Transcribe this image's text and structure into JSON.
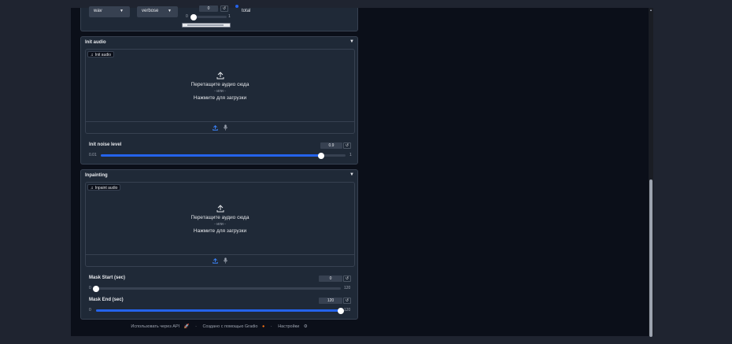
{
  "top": {
    "format_select": "wav",
    "log_select": "verbose",
    "small_num": "0",
    "small_min": "0",
    "small_max": "1",
    "total_label": "total"
  },
  "init_audio": {
    "title": "Init audio",
    "upload_label": "Init audio",
    "drop_text": "Перетащите аудио сюда",
    "or_text": "- или -",
    "click_text": "Нажмите для загрузки",
    "noise_label": "Init noise level",
    "noise_value": "0.9",
    "noise_min": "0.01",
    "noise_max": "1",
    "noise_fraction": 0.9
  },
  "inpainting": {
    "title": "Inpainting",
    "upload_label": "Inpaint audio",
    "drop_text": "Перетащите аудио сюда",
    "or_text": "- или -",
    "click_text": "Нажмите для загрузки",
    "mask_start_label": "Mask Start (sec)",
    "mask_start_value": "0",
    "mask_start_min": "0",
    "mask_start_max": "120",
    "mask_start_fraction": 0,
    "mask_end_label": "Mask End (sec)",
    "mask_end_value": "120",
    "mask_end_min": "0",
    "mask_end_max": "120",
    "mask_end_fraction": 1
  },
  "footer": {
    "api": "Использовать через API",
    "sep1": "·",
    "gradio": "Создано с помощью Gradio",
    "sep2": "·",
    "settings": "Настройки"
  },
  "colors": {
    "accent": "#2563eb",
    "panel": "#1f2937",
    "background": "#0b0f19"
  },
  "icons": [
    "upload-icon",
    "microphone-icon",
    "music-note-icon",
    "reset-icon",
    "rocket-icon",
    "gear-icon"
  ]
}
